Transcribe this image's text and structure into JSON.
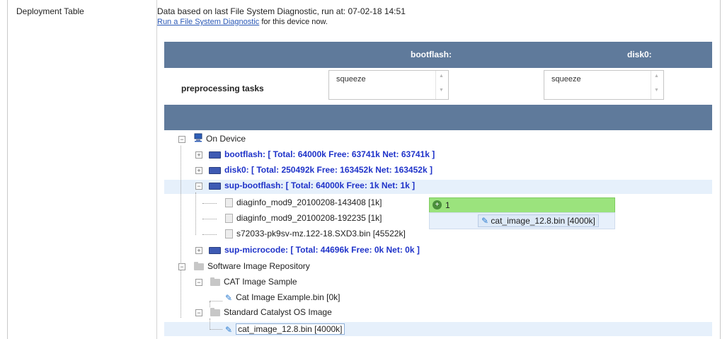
{
  "row_label": "Deployment Table",
  "diagnostic": {
    "info_prefix": "Data based on last File System Diagnostic, run at: ",
    "timestamp": "07-02-18 14:51",
    "link_text": "Run a File System Diagnostic",
    "link_suffix": " for this device now."
  },
  "columns": [
    "bootflash:",
    "disk0:"
  ],
  "preprocessing": {
    "label": "preprocessing tasks",
    "values": [
      "squeeze",
      "squeeze"
    ]
  },
  "tree": {
    "on_device": "On Device",
    "bootflash": "bootflash: [ Total: 64000k Free: 63741k Net: 63741k ]",
    "disk0": "disk0: [ Total: 250492k Free: 163452k Net: 163452k ]",
    "sup_bootflash": "sup-bootflash: [ Total: 64000k Free: 1k Net: 1k ]",
    "files": [
      "diaginfo_mod9_20100208-143408 [1k]",
      "diaginfo_mod9_20100208-192235 [1k]",
      "s72033-pk9sv-mz.122-18.SXD3.bin [45522k]"
    ],
    "sup_microcode": "sup-microcode: [ Total: 44696k Free: 0k Net: 0k ]",
    "repo": "Software Image Repository",
    "cat_sample": "CAT Image Sample",
    "cat_example": "Cat Image Example.bin [0k]",
    "std_catalyst": "Standard Catalyst OS Image",
    "cat_image": "cat_image_12.8.bin [4000k]"
  },
  "drop_popup": {
    "count": "1",
    "item": "cat_image_12.8.bin [4000k]"
  },
  "colors": {
    "header_bg": "#5f7a9b",
    "link": "#2a58b6",
    "blue_bold": "#1f33c9",
    "drop_green": "#9be37d",
    "selection": "#e6f0fb"
  },
  "icons": {
    "expand": "plus-box-icon",
    "collapse": "minus-box-icon",
    "device": "computer-icon",
    "drive": "drive-icon",
    "folder": "folder-icon",
    "file": "file-icon",
    "image": "pen-icon",
    "popup": "add-circle-icon"
  }
}
